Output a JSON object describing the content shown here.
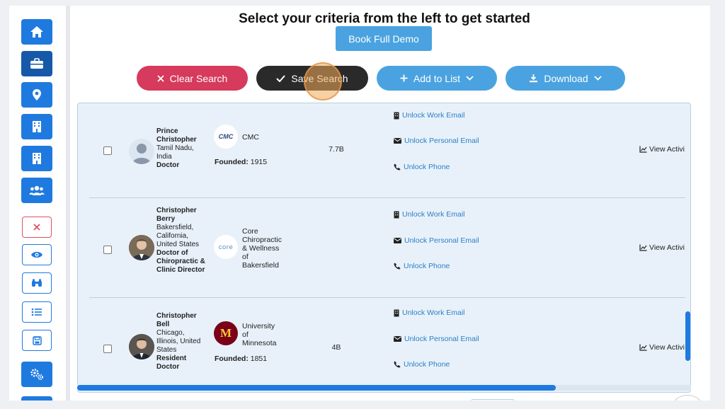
{
  "header": {
    "headline": "Select your criteria from the left to get started",
    "demo_button": "Book Full Demo"
  },
  "actions": {
    "clear": "Clear Search",
    "save": "Save Search",
    "add_to_list": "Add to List",
    "download": "Download"
  },
  "sidebar": {
    "items": [
      {
        "icon": "home-icon"
      },
      {
        "icon": "briefcase-icon"
      },
      {
        "icon": "location-pin-icon"
      },
      {
        "icon": "building-icon"
      },
      {
        "icon": "building-icon"
      },
      {
        "icon": "users-icon"
      },
      {
        "icon": "close-icon"
      },
      {
        "icon": "eye-icon"
      },
      {
        "icon": "binoculars-icon"
      },
      {
        "icon": "list-icon"
      },
      {
        "icon": "save-icon"
      },
      {
        "icon": "settings-icon"
      }
    ]
  },
  "results": [
    {
      "name": "Prince Christopher",
      "location": "Tamil Nadu, India",
      "title": "Doctor",
      "company": "CMC",
      "logo_text": "CMC",
      "founded_label": "Founded:",
      "founded": "1915",
      "revenue": "7.7B",
      "unlock_work_email": "Unlock Work Email",
      "unlock_personal_email": "Unlock Personal Email",
      "unlock_phone": "Unlock Phone",
      "view_activity": "View Activi"
    },
    {
      "name": "Christopher Berry",
      "location": "Bakersfield, California, United States",
      "title": "Doctor of Chiropractic & Clinic Director",
      "company": "Core Chiropractic & Wellness of Bakersfield",
      "logo_text": "core",
      "founded_label": "",
      "founded": "",
      "revenue": "",
      "unlock_work_email": "Unlock Work Email",
      "unlock_personal_email": "Unlock Personal Email",
      "unlock_phone": "Unlock Phone",
      "view_activity": "View Activi"
    },
    {
      "name": "Christopher Bell",
      "location": "Chicago, Illinois, United States",
      "title": "Resident Doctor",
      "company": "University of Minnesota",
      "logo_text": "M",
      "founded_label": "Founded:",
      "founded": "1851",
      "revenue": "4B",
      "unlock_work_email": "Unlock Work Email",
      "unlock_personal_email": "Unlock Personal Email",
      "unlock_phone": "Unlock Phone",
      "view_activity": "View Activi"
    }
  ],
  "colors": {
    "primary": "#1f7ae0",
    "light_blue": "#4aa3e0",
    "danger": "#d63a5c",
    "dark": "#2a2a2a",
    "link": "#2a7fc9"
  }
}
